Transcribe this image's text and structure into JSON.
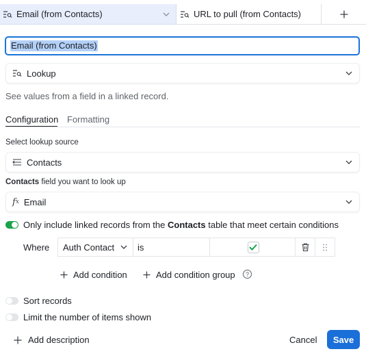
{
  "header": {
    "columns": [
      {
        "label": "Email (from Contacts)",
        "icon": "lookup-icon"
      },
      {
        "label": "URL to pull (from Contacts)",
        "icon": "lookup-icon"
      }
    ],
    "add_icon": "plus-icon"
  },
  "field": {
    "name_value": "Email (from Contacts)",
    "type_label": "Lookup",
    "type_icon": "lookup-icon",
    "description": "See values from a field in a linked record."
  },
  "tabs": [
    {
      "label": "Configuration",
      "active": true
    },
    {
      "label": "Formatting",
      "active": false
    }
  ],
  "config": {
    "source_label": "Select lookup source",
    "source_value": "Contacts",
    "field_label_bold": "Contacts",
    "field_label_rest": " field you want to look up",
    "field_value": "Email",
    "conditions_toggle": {
      "on": true,
      "text_pre": "Only include linked records from the ",
      "text_bold": "Contacts",
      "text_post": " table that meet certain conditions"
    },
    "condition": {
      "where": "Where",
      "field": "Auth Contact",
      "operator": "is",
      "value_checked": true
    },
    "add_condition": "Add condition",
    "add_condition_group": "Add condition group",
    "sort_records": "Sort records",
    "limit_items": "Limit the number of items shown"
  },
  "footer": {
    "add_description": "Add description",
    "cancel": "Cancel",
    "save": "Save"
  },
  "colors": {
    "accent": "#1a6fd8",
    "toggle_on": "#19a34a",
    "check": "#19a34a"
  }
}
